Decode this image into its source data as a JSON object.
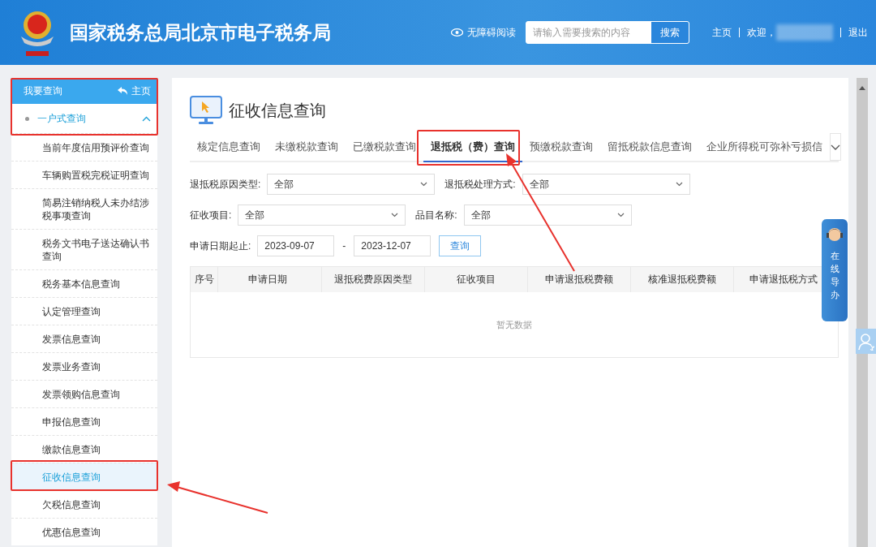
{
  "header": {
    "title": "国家税务总局北京市电子税务局",
    "accessibility_link": "无障碍阅读",
    "search": {
      "placeholder": "请输入需要搜索的内容",
      "button": "搜索"
    },
    "nav": [
      {
        "kind": "link",
        "label": "主页"
      },
      {
        "kind": "text",
        "label": "欢迎，"
      },
      {
        "kind": "masked"
      },
      {
        "kind": "link",
        "label": "退出"
      }
    ]
  },
  "sidebar": {
    "title": "我要查询",
    "home_link": "主页",
    "group": {
      "label": "一户式查询",
      "expanded": true,
      "items": [
        {
          "label": "当前年度信用预评价查询",
          "selected": false
        },
        {
          "label": "车辆购置税完税证明查询",
          "selected": false
        },
        {
          "label": "简易注销纳税人未办结涉税事项查询",
          "selected": false
        },
        {
          "label": "税务文书电子送达确认书查询",
          "selected": false
        },
        {
          "label": "税务基本信息查询",
          "selected": false
        },
        {
          "label": "认定管理查询",
          "selected": false
        },
        {
          "label": "发票信息查询",
          "selected": false
        },
        {
          "label": "发票业务查询",
          "selected": false
        },
        {
          "label": "发票领购信息查询",
          "selected": false
        },
        {
          "label": "申报信息查询",
          "selected": false
        },
        {
          "label": "缴款信息查询",
          "selected": false
        },
        {
          "label": "征收信息查询",
          "selected": true
        },
        {
          "label": "欠税信息查询",
          "selected": false
        },
        {
          "label": "优惠信息查询",
          "selected": false
        }
      ]
    }
  },
  "main": {
    "title": "征收信息查询",
    "tabs": [
      {
        "label": "核定信息查询",
        "selected": false
      },
      {
        "label": "未缴税款查询",
        "selected": false
      },
      {
        "label": "已缴税款查询",
        "selected": false
      },
      {
        "label": "退抵税（费）查询",
        "selected": true
      },
      {
        "label": "预缴税款查询",
        "selected": false
      },
      {
        "label": "留抵税款信息查询",
        "selected": false
      },
      {
        "label": "企业所得税可弥补亏损信",
        "selected": false
      }
    ],
    "filter_rows": [
      [
        {
          "label": "退抵税原因类型:",
          "value": "全部"
        },
        {
          "label": "退抵税处理方式:",
          "value": "全部"
        }
      ],
      [
        {
          "label": "征收项目:",
          "value": "全部"
        },
        {
          "label": "品目名称:",
          "value": "全部"
        }
      ]
    ],
    "date_range": {
      "label": "申请日期起止:",
      "start": "2023-09-07",
      "separator": "-",
      "end": "2023-12-07"
    },
    "query_button": "查询",
    "table": {
      "columns": [
        "序号",
        "申请日期",
        "退抵税费原因类型",
        "征收项目",
        "申请退抵税费额",
        "核准退抵税费额",
        "申请退抵税方式"
      ],
      "empty_text": "暂无数据"
    }
  },
  "help_widget": {
    "label": "在线导办"
  }
}
